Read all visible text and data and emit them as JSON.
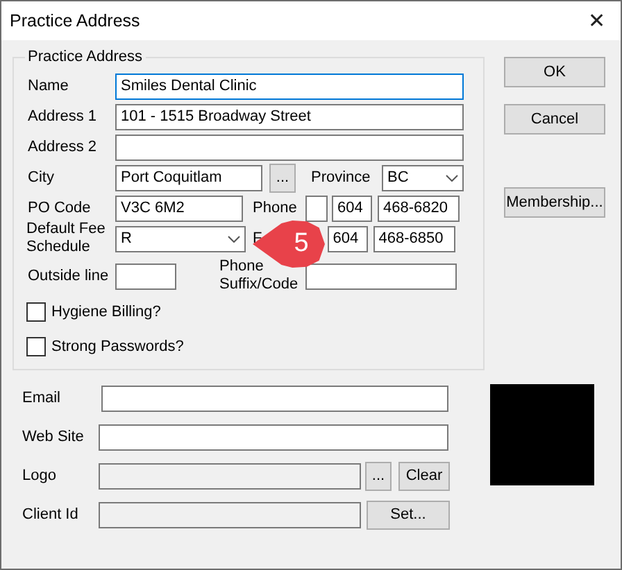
{
  "window": {
    "title": "Practice Address",
    "close": "✕"
  },
  "group": {
    "title": "Practice Address"
  },
  "name": {
    "label": "Name",
    "value": "Smiles Dental Clinic",
    "focused": true
  },
  "address1": {
    "label": "Address 1",
    "value": "101 - 1515 Broadway Street"
  },
  "address2": {
    "label": "Address 2"
  },
  "city": {
    "label": "City",
    "value": "Port Coquitlam",
    "browse": "..."
  },
  "province": {
    "label": "Province",
    "value": "BC"
  },
  "po_code": {
    "label": "PO Code",
    "value": "V3C 6M2"
  },
  "phone": {
    "label": "Phone",
    "area": "604",
    "number": "468-6820"
  },
  "fee_schedule": {
    "label": "Default Fee Schedule",
    "value": "R"
  },
  "fax": {
    "label": "F",
    "area": "604",
    "number": "468-6850"
  },
  "outside_line": {
    "label": "Outside line"
  },
  "phone_suffix": {
    "label": "Phone Suffix/Code"
  },
  "checkboxes": [
    {
      "label": "Hygiene Billing?",
      "checked": false
    },
    {
      "label": "Strong Passwords?",
      "checked": false
    }
  ],
  "email": {
    "label": "Email"
  },
  "web_site": {
    "label": "Web Site"
  },
  "logo": {
    "label": "Logo",
    "disabled": true,
    "browse": "...",
    "clear": "Clear"
  },
  "client_id": {
    "label": "Client Id",
    "disabled": true,
    "set": "Set..."
  },
  "buttons": [
    "OK",
    "Cancel",
    "Membership..."
  ],
  "callout": {
    "label": "5"
  }
}
